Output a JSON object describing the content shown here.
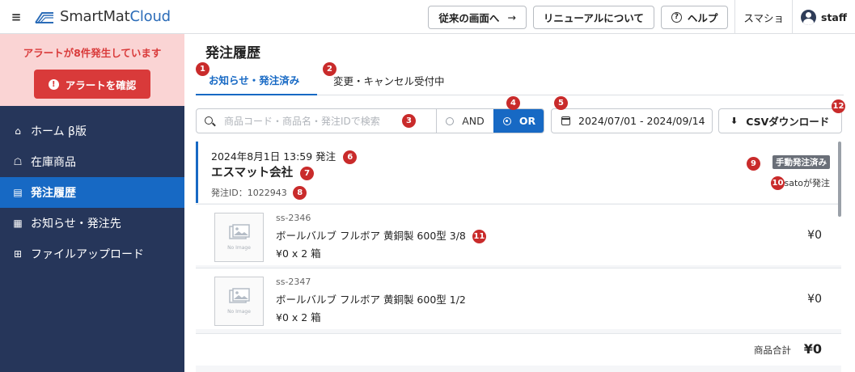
{
  "app": {
    "logo_main": "SmartMat",
    "logo_cloud": "Cloud"
  },
  "topbar": {
    "legacy_view": "従来の画面へ",
    "legacy_arrow": "→",
    "renewal": "リニューアルについて",
    "help": "ヘルプ",
    "help_glyph": "?",
    "smartphone": "スマショ",
    "user": "staff"
  },
  "sidebar": {
    "alert_text": "アラートが8件発生しています",
    "alert_button": "アラートを確認",
    "items": [
      {
        "label": "ホーム β版",
        "icon": "home-icon",
        "glyph": "⌂"
      },
      {
        "label": "在庫商品",
        "icon": "inventory-icon",
        "glyph": "☖"
      },
      {
        "label": "発注履歴",
        "icon": "clipboard-icon",
        "glyph": "▤",
        "active": true
      },
      {
        "label": "お知らせ・発注先",
        "icon": "building-icon",
        "glyph": "▦"
      },
      {
        "label": "ファイルアップロード",
        "icon": "file-upload-icon",
        "glyph": "⊞"
      }
    ]
  },
  "main": {
    "title": "発注履歴",
    "tabs": [
      {
        "label": "お知らせ・発注済み",
        "badge": "1",
        "active": true
      },
      {
        "label": "変更・キャンセル受付中",
        "badge": "2"
      }
    ],
    "search": {
      "placeholder": "商品コード・商品名・発注IDで検索",
      "badge": "3"
    },
    "filter": {
      "and_label": "AND",
      "or_label": "OR",
      "selected": "OR",
      "badge": "4"
    },
    "date_range": {
      "value": "2024/07/01 - 2024/09/14",
      "badge": "5"
    },
    "csv": {
      "label": "CSVダウンロード",
      "glyph": "⬇",
      "badge": "12"
    }
  },
  "order": {
    "datetime": "2024年8月1日 13:59 発注",
    "datetime_badge": "6",
    "supplier": "エスマット会社",
    "supplier_badge": "7",
    "order_id": "発注ID：1022943",
    "order_id_badge": "8",
    "status": "手動発注済み",
    "status_badge": "9",
    "ordered_by": "satoが発注",
    "ordered_by_badge": "10",
    "items": [
      {
        "code": "ss-2346",
        "name": "ボールバルブ フルボア 黄銅製 600型 3/8",
        "qty": "¥0 x 2 箱",
        "price": "¥0",
        "badge": "11",
        "no_image": "No Image"
      },
      {
        "code": "ss-2347",
        "name": "ボールバルブ フルボア 黄銅製 600型 1/2",
        "qty": "¥0 x 2 箱",
        "price": "¥0",
        "no_image": "No Image"
      }
    ],
    "total_label": "商品合計",
    "total_value": "¥0"
  },
  "colors": {
    "accent": "#1769c4",
    "sidebar": "#26365a",
    "alert": "#d93a3a",
    "badge": "#c92b2b"
  }
}
